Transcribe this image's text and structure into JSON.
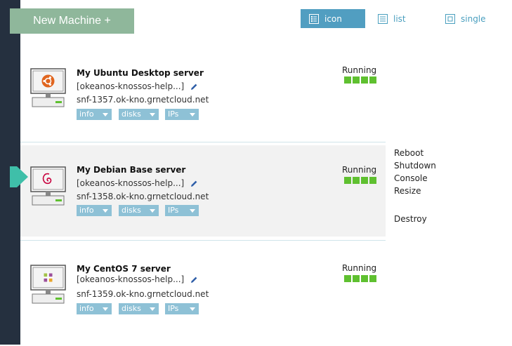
{
  "new_machine_label": "New Machine +",
  "view_tabs": [
    {
      "label": "icon",
      "icon": "icon-view-icon",
      "active": true
    },
    {
      "label": "list",
      "icon": "list-view-icon",
      "active": false
    },
    {
      "label": "single",
      "icon": "single-view-icon",
      "active": false
    }
  ],
  "machines": [
    {
      "name": "My Ubuntu Desktop server",
      "group": "[okeanos-knossos-help...]",
      "host": "snf-1357.ok-kno.grnetcloud.net",
      "status": "Running",
      "os_icon": "ubuntu-logo-icon",
      "buttons": {
        "info": "info",
        "disks": "disks",
        "ips": "IPs"
      }
    },
    {
      "name": "My Debian Base server",
      "group": "[okeanos-knossos-help...]",
      "host": "snf-1358.ok-kno.grnetcloud.net",
      "status": "Running",
      "os_icon": "debian-logo-icon",
      "buttons": {
        "info": "info",
        "disks": "disks",
        "ips": "IPs"
      }
    },
    {
      "name": "My CentOS 7 server",
      "group": "[okeanos-knossos-help...]",
      "host": "snf-1359.ok-kno.grnetcloud.net",
      "status": "Running",
      "os_icon": "centos-logo-icon",
      "buttons": {
        "info": "info",
        "disks": "disks",
        "ips": "IPs"
      }
    }
  ],
  "actions": {
    "reboot": "Reboot",
    "shutdown": "Shutdown",
    "console": "Console",
    "resize": "Resize",
    "destroy": "Destroy"
  },
  "colors": {
    "sidebar": "#25303f",
    "new_button": "#8fb79b",
    "active_tab": "#519ec1",
    "pill": "#8ec1d6",
    "status_running": "#5fc030",
    "selection_pointer": "#3fbfa9"
  }
}
